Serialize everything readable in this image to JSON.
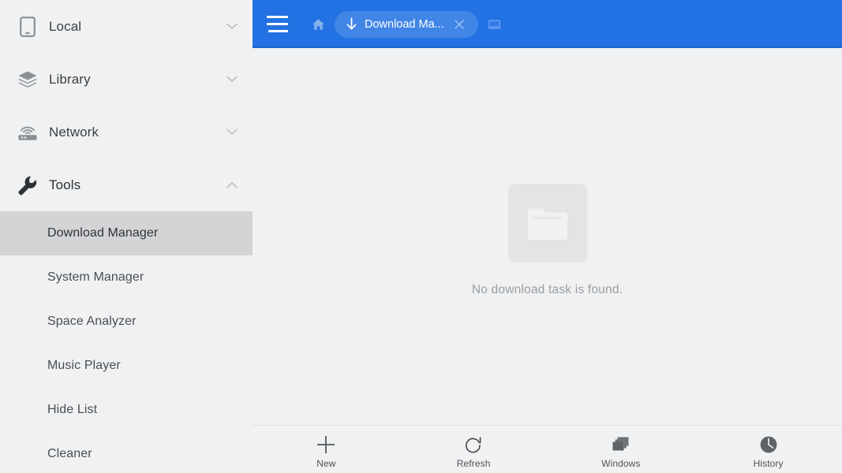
{
  "sidebar": {
    "groups": [
      {
        "label": "Local",
        "icon": "phone-icon",
        "expanded": false,
        "chevron": "chevron-down-icon"
      },
      {
        "label": "Library",
        "icon": "layers-icon",
        "expanded": false,
        "chevron": "chevron-down-icon"
      },
      {
        "label": "Network",
        "icon": "router-icon",
        "expanded": false,
        "chevron": "chevron-down-icon"
      },
      {
        "label": "Tools",
        "icon": "wrench-icon",
        "expanded": true,
        "chevron": "chevron-up-icon"
      }
    ],
    "tools_items": [
      {
        "label": "Download Manager",
        "selected": true
      },
      {
        "label": "System Manager",
        "selected": false
      },
      {
        "label": "Space Analyzer",
        "selected": false
      },
      {
        "label": "Music Player",
        "selected": false
      },
      {
        "label": "Hide List",
        "selected": false
      },
      {
        "label": "Cleaner",
        "selected": false
      }
    ]
  },
  "topbar": {
    "menu_icon": "hamburger-menu-icon",
    "home_icon": "home-icon",
    "tab": {
      "icon": "download-arrow-icon",
      "title": "Download Ma...",
      "close_icon": "close-icon"
    },
    "window_icon": "window-icon",
    "background_color": "#2272e3"
  },
  "content": {
    "empty_state": {
      "icon": "folder-icon",
      "message": "No download task is found."
    }
  },
  "bottombar": {
    "items": [
      {
        "label": "New",
        "icon": "plus-icon"
      },
      {
        "label": "Refresh",
        "icon": "refresh-icon"
      },
      {
        "label": "Windows",
        "icon": "windows-stack-icon"
      },
      {
        "label": "History",
        "icon": "clock-icon"
      }
    ]
  },
  "colors": {
    "accent": "#2272e3",
    "sidebar_bg": "#f0f1f2",
    "selected_row": "#d3d4d6",
    "muted_text": "#9a9ea1"
  }
}
